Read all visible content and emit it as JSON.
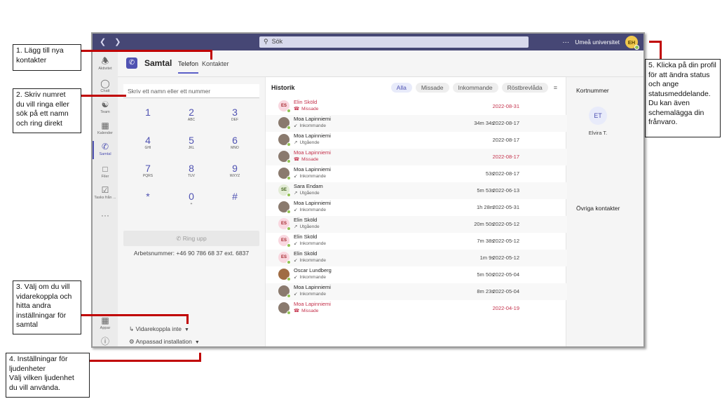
{
  "callouts": {
    "c1": "1. Lägg till nya\nkontakter",
    "c2": "2. Skriv numret\ndu vill ringa eller\nsök på ett namn\noch ring direkt",
    "c3": "3. Välj om du vill\nvidarekoppla och\nhitta andra\ninställningar för\nsamtal",
    "c4": "4. Inställningar för\nljudenheter\nVälj vilken ljudenhet\ndu vill använda.",
    "c5": "5. Klicka på din profil\nför att ändra status\noch ange\nstatusmeddelande.\nDu kan även\nschemalägga din\nfrånvaro."
  },
  "topbar": {
    "search_placeholder": "Sök",
    "more": "···",
    "org": "Umeå universitet",
    "avatar_initials": "EH"
  },
  "rail": {
    "items": [
      {
        "label": "Aktivitet",
        "icon": "bell-icon"
      },
      {
        "label": "Chatt",
        "icon": "chat-icon"
      },
      {
        "label": "Team",
        "icon": "teams-icon"
      },
      {
        "label": "Kalender",
        "icon": "calendar-icon"
      },
      {
        "label": "Samtal",
        "icon": "phone-icon"
      },
      {
        "label": "Filer",
        "icon": "file-icon"
      },
      {
        "label": "Tasks från ...",
        "icon": "tasks-icon"
      },
      {
        "label": "···",
        "icon": "more-icon"
      },
      {
        "label": "Appar",
        "icon": "apps-icon"
      },
      {
        "label": "",
        "icon": "help-icon"
      }
    ]
  },
  "header": {
    "title": "Samtal",
    "tab_phone": "Telefon",
    "tab_contacts": "Kontakter"
  },
  "dialpad": {
    "placeholder": "Skriv ett namn eller ett nummer",
    "keys": [
      {
        "num": "1",
        "let": ""
      },
      {
        "num": "2",
        "let": "ABC"
      },
      {
        "num": "3",
        "let": "DEF"
      },
      {
        "num": "4",
        "let": "GHI"
      },
      {
        "num": "5",
        "let": "JKL"
      },
      {
        "num": "6",
        "let": "MNO"
      },
      {
        "num": "7",
        "let": "PQRS"
      },
      {
        "num": "8",
        "let": "TUV"
      },
      {
        "num": "9",
        "let": "WXYZ"
      },
      {
        "num": "*",
        "let": ""
      },
      {
        "num": "0",
        "let": "+"
      },
      {
        "num": "#",
        "let": ""
      }
    ],
    "call_button": "Ring upp",
    "work_number": "Arbetsnummer: +46 90 786 68 37 ext. 6837",
    "forwarding": "Vidarekoppla inte",
    "device": "Anpassad installation"
  },
  "history": {
    "title": "Historik",
    "filters": [
      "Alla",
      "Missade",
      "Inkommande",
      "Röstbrevlåda"
    ],
    "rows": [
      {
        "initials": "ES",
        "name": "Elin Sköld",
        "type": "Missade",
        "duration": "",
        "date": "2022-08-31",
        "missed": true,
        "av": "es"
      },
      {
        "initials": "",
        "name": "Moa Lapinniemi",
        "type": "Inkommande",
        "duration": "34m 34s",
        "date": "2022-08-17",
        "missed": false,
        "av": "photo"
      },
      {
        "initials": "",
        "name": "Moa Lapinniemi",
        "type": "Utgående",
        "duration": "",
        "date": "2022-08-17",
        "missed": false,
        "av": "photo"
      },
      {
        "initials": "",
        "name": "Moa Lapinniemi",
        "type": "Missade",
        "duration": "",
        "date": "2022-08-17",
        "missed": true,
        "av": "photo"
      },
      {
        "initials": "",
        "name": "Moa Lapinniemi",
        "type": "Inkommande",
        "duration": "53s",
        "date": "2022-08-17",
        "missed": false,
        "av": "photo"
      },
      {
        "initials": "SE",
        "name": "Sara Endam",
        "type": "Utgående",
        "duration": "5m 53s",
        "date": "2022-06-13",
        "missed": false,
        "av": "se"
      },
      {
        "initials": "",
        "name": "Moa Lapinniemi",
        "type": "Inkommande",
        "duration": "1h 28m",
        "date": "2022-05-31",
        "missed": false,
        "av": "photo"
      },
      {
        "initials": "ES",
        "name": "Elin Sköld",
        "type": "Utgående",
        "duration": "20m 50s",
        "date": "2022-05-12",
        "missed": false,
        "av": "es"
      },
      {
        "initials": "ES",
        "name": "Elin Sköld",
        "type": "Inkommande",
        "duration": "7m 38s",
        "date": "2022-05-12",
        "missed": false,
        "av": "es"
      },
      {
        "initials": "ES",
        "name": "Elin Sköld",
        "type": "Inkommande",
        "duration": "1m 9s",
        "date": "2022-05-12",
        "missed": false,
        "av": "es"
      },
      {
        "initials": "",
        "name": "Oscar Lundberg",
        "type": "Inkommande",
        "duration": "5m 50s",
        "date": "2022-05-04",
        "missed": false,
        "av": "photo2"
      },
      {
        "initials": "",
        "name": "Moa Lapinniemi",
        "type": "Inkommande",
        "duration": "8m 23s",
        "date": "2022-05-04",
        "missed": false,
        "av": "photo"
      },
      {
        "initials": "",
        "name": "Moa Lapinniemi",
        "type": "Missade",
        "duration": "",
        "date": "2022-04-19",
        "missed": true,
        "av": "photo"
      }
    ]
  },
  "speed_dial": {
    "title": "Kortnummer",
    "contact_initials": "ET",
    "contact_name": "Elvira T.",
    "other_title": "Övriga kontakter"
  },
  "colors": {
    "accent": "#4f52b2",
    "topbar": "#464775",
    "missed": "#c4314b",
    "callout_line": "#c00000"
  }
}
